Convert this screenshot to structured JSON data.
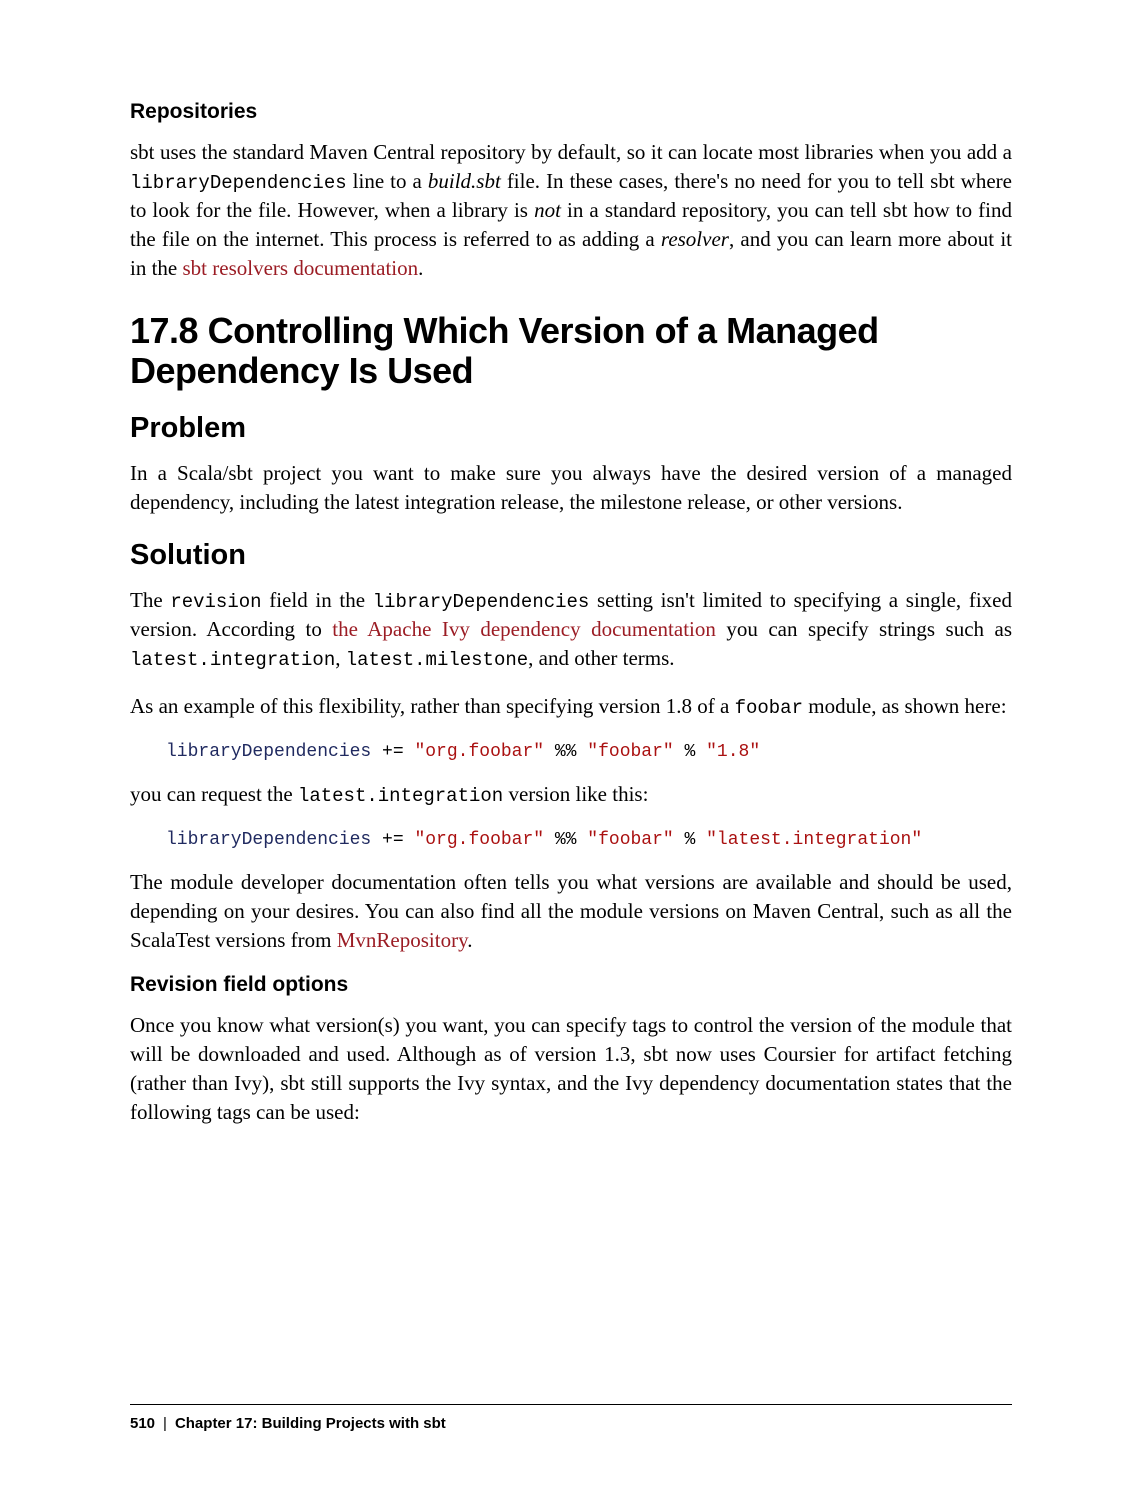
{
  "sec_repositories": {
    "heading": "Repositories",
    "p1_a": "sbt uses the standard Maven Central repository by default, so it can locate most libraries when you add a ",
    "p1_code1": "libraryDependencies",
    "p1_b": " line to a ",
    "p1_ital1": "build.sbt",
    "p1_c": " file. In these cases, there's no need for you to tell sbt where to look for the file. However, when a library is ",
    "p1_ital2": "not",
    "p1_d": " in a standard repository, you can tell sbt how to find the file on the internet. This process is referred to as adding a ",
    "p1_ital3": "resolver",
    "p1_e": ", and you can learn more about it in the ",
    "p1_link": "sbt resolvers documentation",
    "p1_f": "."
  },
  "sec_178": {
    "heading": "17.8 Controlling Which Version of a Managed Dependency Is Used",
    "problem_heading": "Problem",
    "problem_p": "In a Scala/sbt project you want to make sure you always have the desired version of a managed dependency, including the latest integration release, the milestone release, or other versions.",
    "solution_heading": "Solution",
    "sol_p1_a": "The ",
    "sol_p1_code1": "revision",
    "sol_p1_b": " field in the ",
    "sol_p1_code2": "libraryDependencies",
    "sol_p1_c": " setting isn't limited to specifying a single, fixed version. According to ",
    "sol_p1_link": "the Apache Ivy dependency documentation",
    "sol_p1_d": " you can specify strings such as ",
    "sol_p1_code3": "latest.integration",
    "sol_p1_e": ", ",
    "sol_p1_code4": "latest.milestone",
    "sol_p1_f": ", and other terms.",
    "sol_p2_a": "As an example of this flexibility, rather than specifying version 1.8 of a ",
    "sol_p2_code1": "foobar",
    "sol_p2_b": " module, as shown here:",
    "code1_key": "libraryDependencies",
    "code1_op": " += ",
    "code1_s1": "\"org.foobar\"",
    "code1_pct": " %% ",
    "code1_s2": "\"foobar\"",
    "code1_pct2": " % ",
    "code1_s3": "\"1.8\"",
    "sol_p3_a": "you can request the ",
    "sol_p3_code1": "latest.integration",
    "sol_p3_b": " version like this:",
    "code2_key": "libraryDependencies",
    "code2_op": " += ",
    "code2_s1": "\"org.foobar\"",
    "code2_pct": " %% ",
    "code2_s2": "\"foobar\"",
    "code2_pct2": " % ",
    "code2_s3": "\"latest.integration\"",
    "sol_p4_a": "The module developer documentation often tells you what versions are available and should be used, depending on your desires. You can also find all the module versions on Maven Central, such as all the ScalaTest versions from ",
    "sol_p4_link": "MvnRepository",
    "sol_p4_b": ".",
    "rev_heading": "Revision field options",
    "rev_p": "Once you know what version(s) you want, you can specify tags to control the version of the module that will be downloaded and used. Although as of version 1.3, sbt now uses Coursier for artifact fetching (rather than Ivy), sbt still supports the Ivy syntax, and the Ivy dependency documentation states that the following tags can be used:"
  },
  "footer": {
    "page": "510",
    "chapter": "Chapter 17: Building Projects with sbt"
  }
}
